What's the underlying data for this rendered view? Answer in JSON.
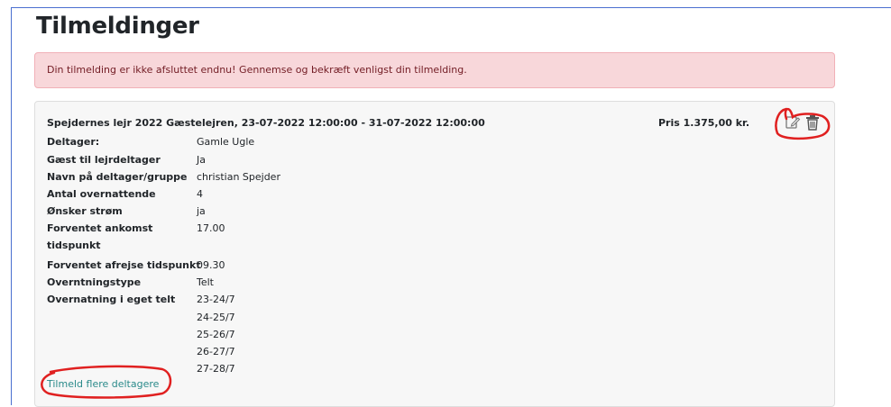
{
  "page": {
    "title": "Tilmeldinger",
    "alert": "Din tilmelding er ikke afsluttet endnu! Gennemse og bekræft venligst din tilmelding."
  },
  "registration": {
    "event": "Spejdernes lejr 2022 Gæstelejren, 23-07-2022 12:00:00 - 31-07-2022 12:00:00",
    "price": "Pris 1.375,00 kr.",
    "fields": [
      {
        "label": "Deltager:",
        "value": "Gamle Ugle"
      },
      {
        "label": "Gæst til lejrdeltager",
        "value": "Ja"
      },
      {
        "label": "Navn på deltager/gruppe",
        "value": "christian Spejder"
      },
      {
        "label": "Antal overnattende",
        "value": "4"
      },
      {
        "label": "Ønsker strøm",
        "value": "ja"
      },
      {
        "label": "Forventet ankomst",
        "value": "17.00"
      },
      {
        "label": "tidspunkt",
        "value": ""
      },
      {
        "label": "Forventet afrejse tidspunkt",
        "value": "09.30"
      },
      {
        "label": "Overntningstype",
        "value": "Telt"
      },
      {
        "label": "Overnatning i eget telt",
        "value": "23-24/7"
      }
    ],
    "extra_values": [
      "24-25/7",
      "25-26/7",
      "26-27/7",
      "27-28/7"
    ],
    "add_more_link": "Tilmeld flere deltagere",
    "icons": {
      "edit": "edit-icon",
      "delete": "trash-icon"
    }
  },
  "colors": {
    "alert_bg": "#f8d7da",
    "alert_text": "#721c24",
    "link": "#2a8a8a",
    "annotation": "#e02020"
  }
}
